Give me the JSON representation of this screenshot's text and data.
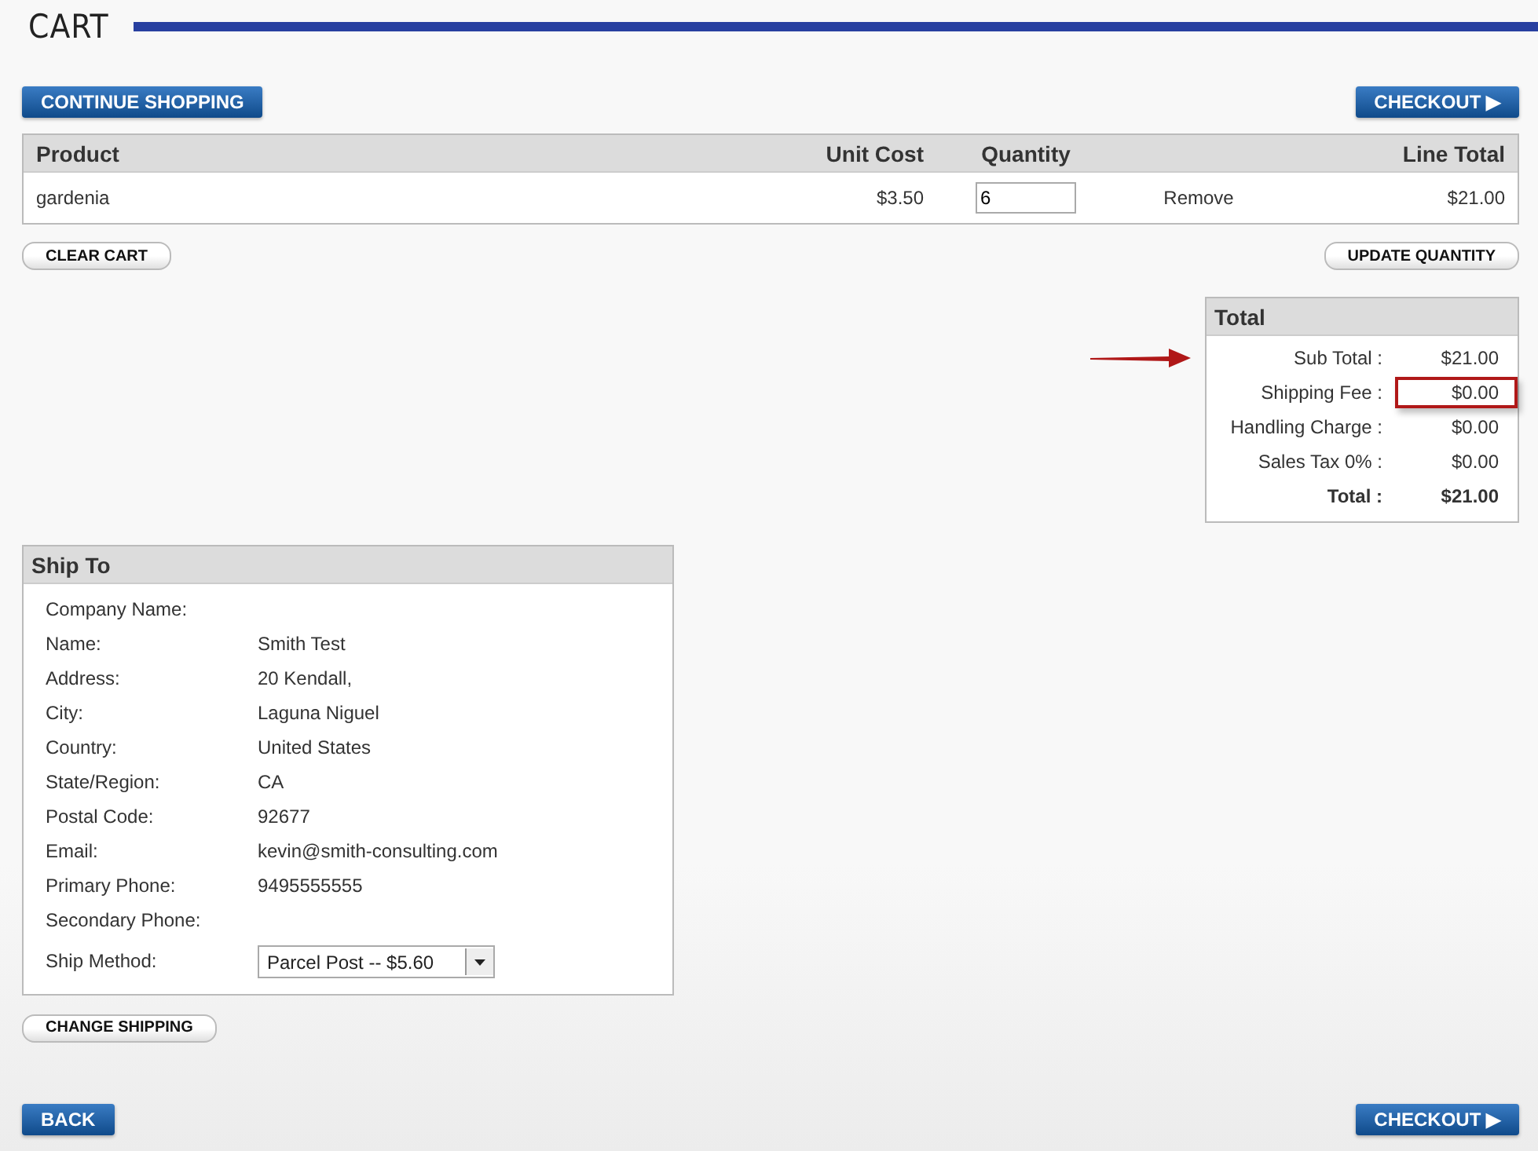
{
  "title": "CART",
  "top_buttons": [
    {
      "label": "CONTINUE SHOPPING",
      "kind": "primary"
    },
    {
      "label": "CHECKOUT ▶",
      "kind": "primary"
    }
  ],
  "cart_table": {
    "columns": [
      "Product",
      "Unit Cost",
      "Quantity",
      "",
      "Line Total"
    ],
    "rows": [
      {
        "product": "gardenia",
        "unit_cost": "$3.50",
        "quantity": "6",
        "action": "Remove",
        "line_total": "$21.00"
      }
    ]
  },
  "table_buttons": [
    {
      "label": "CLEAR CART"
    },
    {
      "label": "UPDATE QUANTITY"
    }
  ],
  "totals": {
    "title": "Total",
    "rows": [
      {
        "label": "Sub Total :",
        "value": "$21.00",
        "bold": false,
        "pointed": true,
        "highlighted": false
      },
      {
        "label": "Shipping Fee :",
        "value": "$0.00",
        "bold": false,
        "pointed": false,
        "highlighted": true
      },
      {
        "label": "Handling Charge :",
        "value": "$0.00",
        "bold": false,
        "pointed": false,
        "highlighted": false
      },
      {
        "label": "Sales Tax 0% :",
        "value": "$0.00",
        "bold": false,
        "pointed": false,
        "highlighted": false
      },
      {
        "label": "Total :",
        "value": "$21.00",
        "bold": true,
        "pointed": false,
        "highlighted": false
      }
    ]
  },
  "ship_to": {
    "title": "Ship To",
    "fields": [
      {
        "label": "Company Name:",
        "kind": "text"
      },
      {
        "label": "Name:",
        "value": "Smith Test",
        "kind": "text"
      },
      {
        "label": "Address:",
        "value": "20 Kendall,",
        "kind": "text"
      },
      {
        "label": "City:",
        "value": "Laguna Niguel",
        "kind": "text"
      },
      {
        "label": "Country:",
        "value": "United States",
        "kind": "text"
      },
      {
        "label": "State/Region:",
        "value": "CA",
        "kind": "text"
      },
      {
        "label": "Postal Code:",
        "value": "92677",
        "kind": "text"
      },
      {
        "label": "Email:",
        "value": "kevin@smith-consulting.com",
        "kind": "text"
      },
      {
        "label": "Primary Phone:",
        "value": "9495555555",
        "kind": "text"
      },
      {
        "label": "Secondary Phone:",
        "kind": "text"
      },
      {
        "label": "Ship Method:",
        "value": "Parcel Post -- $5.60",
        "kind": "select"
      }
    ]
  },
  "change_button": {
    "label": "CHANGE SHIPPING"
  },
  "bottom_buttons": [
    {
      "label": "BACK",
      "kind": "primary"
    },
    {
      "label": "CHECKOUT ▶",
      "kind": "primary"
    }
  ]
}
